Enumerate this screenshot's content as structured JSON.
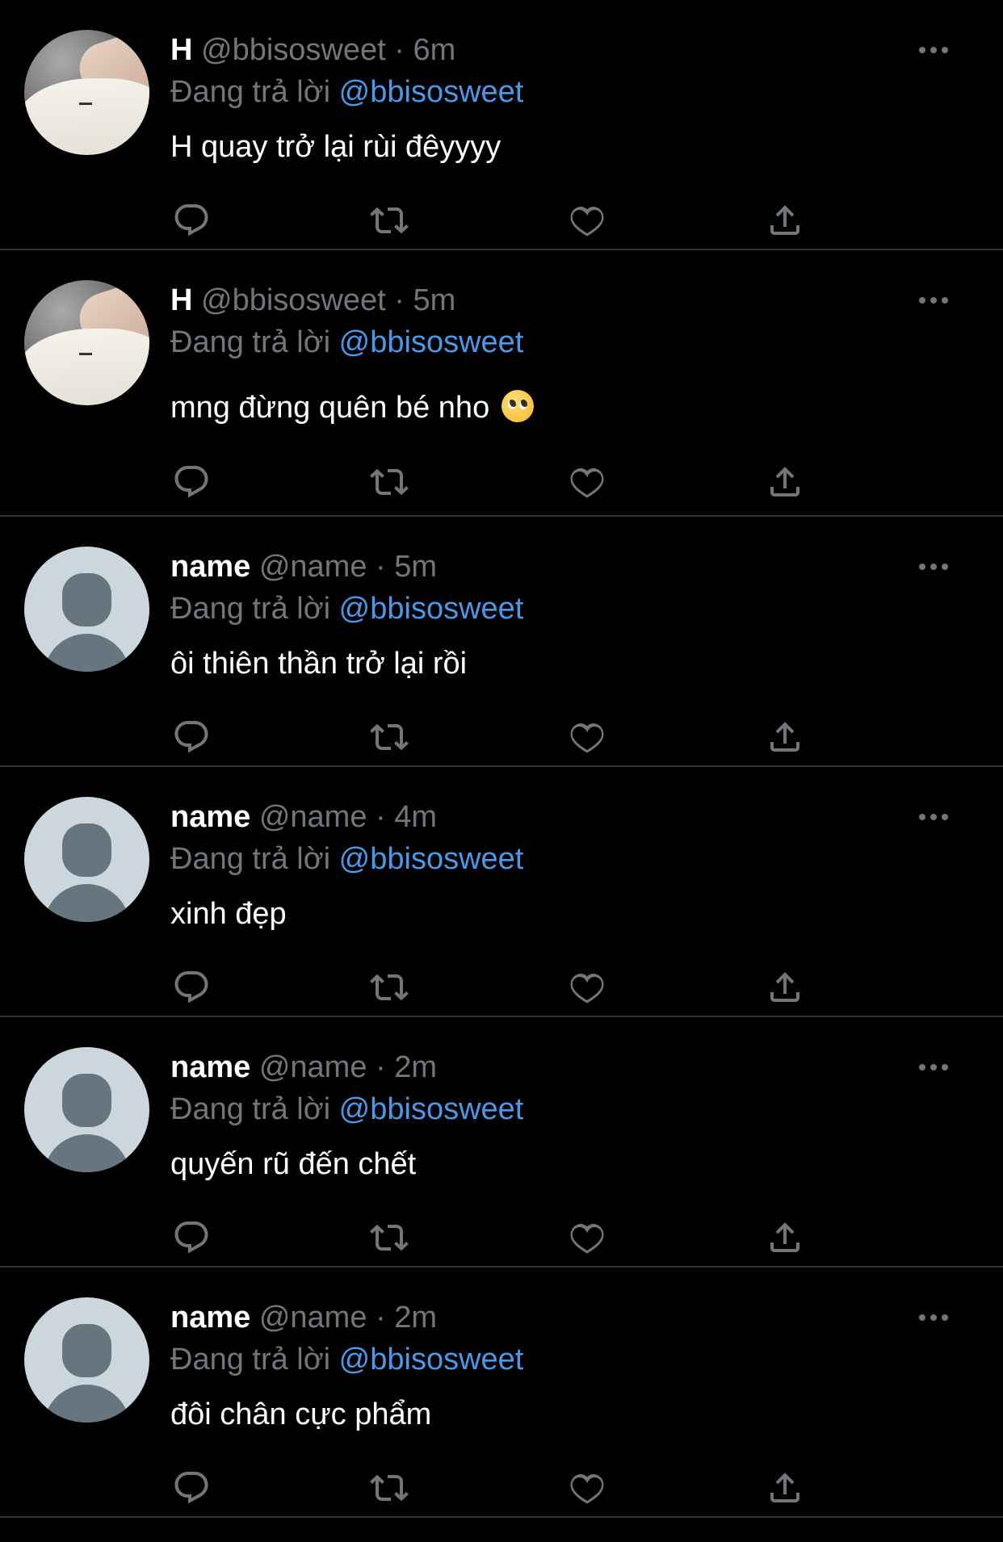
{
  "reply_prefix": "Đang trả lời",
  "tweets": [
    {
      "name": "H",
      "handle": "@bbisosweet",
      "separator": "·",
      "time": "6m",
      "reply_to": "@bbisosweet",
      "text": "H quay trở lại rùi đêyyyy",
      "avatar": "photo"
    },
    {
      "name": "H",
      "handle": "@bbisosweet",
      "separator": "·",
      "time": "5m",
      "reply_to": "@bbisosweet",
      "text": "mng đừng quên bé nho",
      "emoji": "pleading-face",
      "avatar": "photo"
    },
    {
      "name": "name",
      "handle": "@name",
      "separator": "·",
      "time": "5m",
      "reply_to": "@bbisosweet",
      "text": "ôi thiên thần trở lại rồi",
      "avatar": "default"
    },
    {
      "name": "name",
      "handle": "@name",
      "separator": "·",
      "time": "4m",
      "reply_to": "@bbisosweet",
      "text": "xinh đẹp",
      "avatar": "default"
    },
    {
      "name": "name",
      "handle": "@name",
      "separator": "·",
      "time": "2m",
      "reply_to": "@bbisosweet",
      "text": "quyến rũ đến chết",
      "avatar": "default"
    },
    {
      "name": "name",
      "handle": "@name",
      "separator": "·",
      "time": "2m",
      "reply_to": "@bbisosweet",
      "text": "đôi chân cực phẩm",
      "avatar": "default"
    }
  ],
  "colors": {
    "background": "#000000",
    "text": "#ffffff",
    "muted": "#71767b",
    "mention": "#4a99e9",
    "divider": "#2f3336",
    "icon": "#71767b",
    "default_avatar_bg": "#ccd6dd",
    "default_avatar_fg": "#66757f"
  },
  "icons": [
    "reply-icon",
    "retweet-icon",
    "like-icon",
    "share-icon",
    "more-icon"
  ]
}
